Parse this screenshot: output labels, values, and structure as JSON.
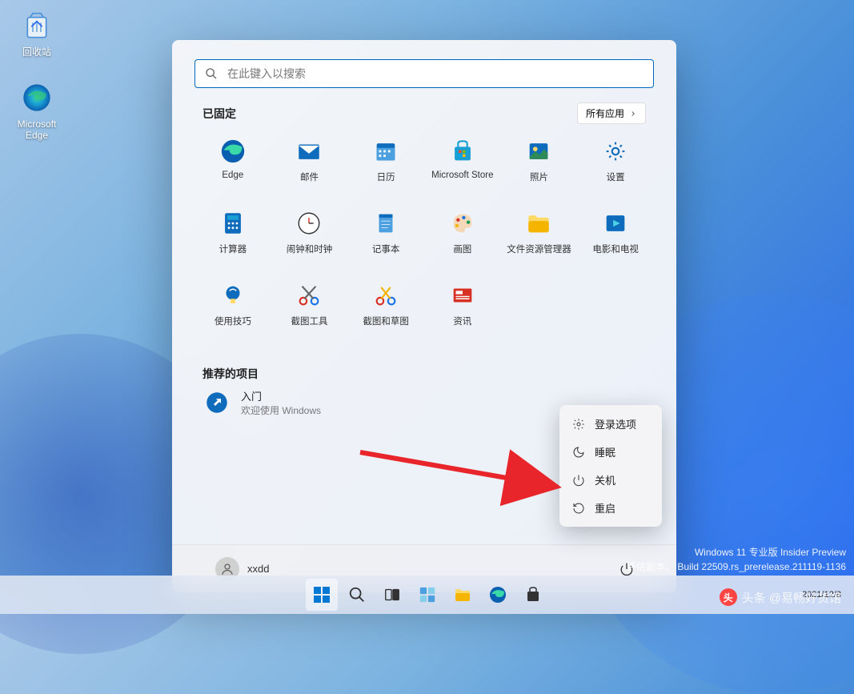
{
  "desktop": {
    "recycle_bin": "回收站",
    "edge": "Microsoft Edge"
  },
  "start": {
    "search_placeholder": "在此键入以搜索",
    "pinned_title": "已固定",
    "all_apps": "所有应用",
    "recommended_title": "推荐的项目",
    "apps": [
      {
        "label": "Edge"
      },
      {
        "label": "邮件"
      },
      {
        "label": "日历"
      },
      {
        "label": "Microsoft Store"
      },
      {
        "label": "照片"
      },
      {
        "label": "设置"
      },
      {
        "label": "计算器"
      },
      {
        "label": "闹钟和时钟"
      },
      {
        "label": "记事本"
      },
      {
        "label": "画图"
      },
      {
        "label": "文件资源管理器"
      },
      {
        "label": "电影和电视"
      },
      {
        "label": "使用技巧"
      },
      {
        "label": "截图工具"
      },
      {
        "label": "截图和草图"
      },
      {
        "label": "资讯"
      }
    ],
    "rec": {
      "title": "入门",
      "sub": "欢迎使用 Windows"
    },
    "user": "xxdd"
  },
  "power_menu": {
    "signin": "登录选项",
    "sleep": "睡眠",
    "shutdown": "关机",
    "restart": "重启"
  },
  "build": {
    "line1": "Windows 11 专业版 Insider Preview",
    "line2": "评估副本。 Build 22509.rs_prerelease.211119-1136"
  },
  "tray": {
    "date": "2021/12/8"
  },
  "watermark": "头条 @易畅好货馆"
}
